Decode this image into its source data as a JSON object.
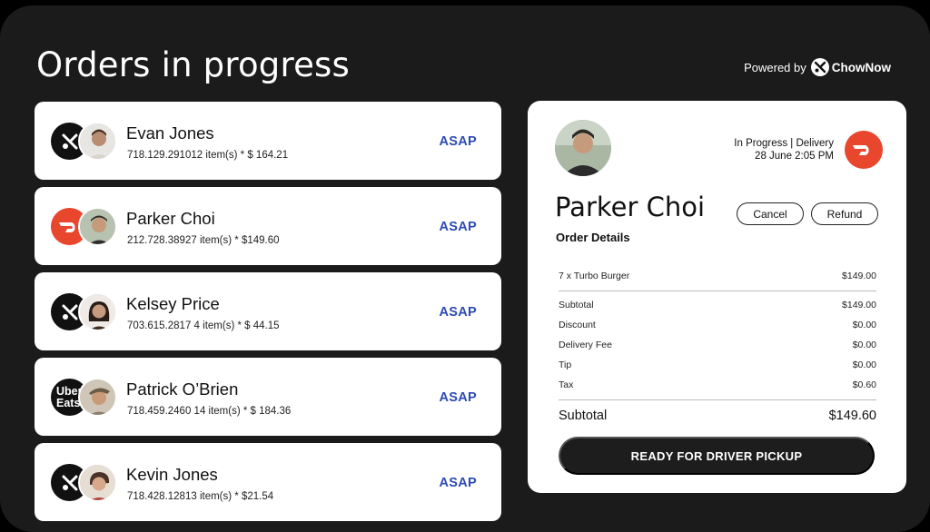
{
  "header": {
    "title": "Orders in progress",
    "powered_by": "Powered by",
    "brand": "ChowNow"
  },
  "orders": [
    {
      "name": "Evan Jones",
      "meta": "718.129.291012 item(s) * $ 164.21",
      "timing": "ASAP",
      "source": "chownow"
    },
    {
      "name": "Parker Choi",
      "meta": "212.728.38927 item(s) * $149.60",
      "timing": "ASAP",
      "source": "doordash"
    },
    {
      "name": "Kelsey Price",
      "meta": "703.615.2817 4 item(s) * $ 44.15",
      "timing": "ASAP",
      "source": "chownow"
    },
    {
      "name": "Patrick O’Brien",
      "meta": "718.459.2460 14 item(s) * $ 184.36",
      "timing": "ASAP",
      "source": "ubereats"
    },
    {
      "name": "Kevin Jones",
      "meta": "718.428.12813 item(s) * $21.54",
      "timing": "ASAP",
      "source": "chownow"
    }
  ],
  "ubereats_logo": "Uber Eats",
  "detail": {
    "status": "In Progress | Delivery",
    "datetime": "28 June 2:05 PM",
    "customer": "Parker Choi",
    "section": "Order Details",
    "cancel": "Cancel",
    "refund": "Refund",
    "item": {
      "label": "7 x Turbo Burger",
      "value": "$149.00"
    },
    "lines": [
      {
        "label": "Subtotal",
        "value": "$149.00"
      },
      {
        "label": "Discount",
        "value": "$0.00"
      },
      {
        "label": "Delivery Fee",
        "value": "$0.00"
      },
      {
        "label": "Tip",
        "value": "$0.00"
      },
      {
        "label": "Tax",
        "value": "$0.60"
      }
    ],
    "total": {
      "label": "Subtotal",
      "value": "$149.60"
    },
    "action": "READY FOR DRIVER PICKUP"
  },
  "colors": {
    "background": "#1b1b1b",
    "accent_blue": "#2c4bb3",
    "doordash_red": "#e8462d"
  }
}
